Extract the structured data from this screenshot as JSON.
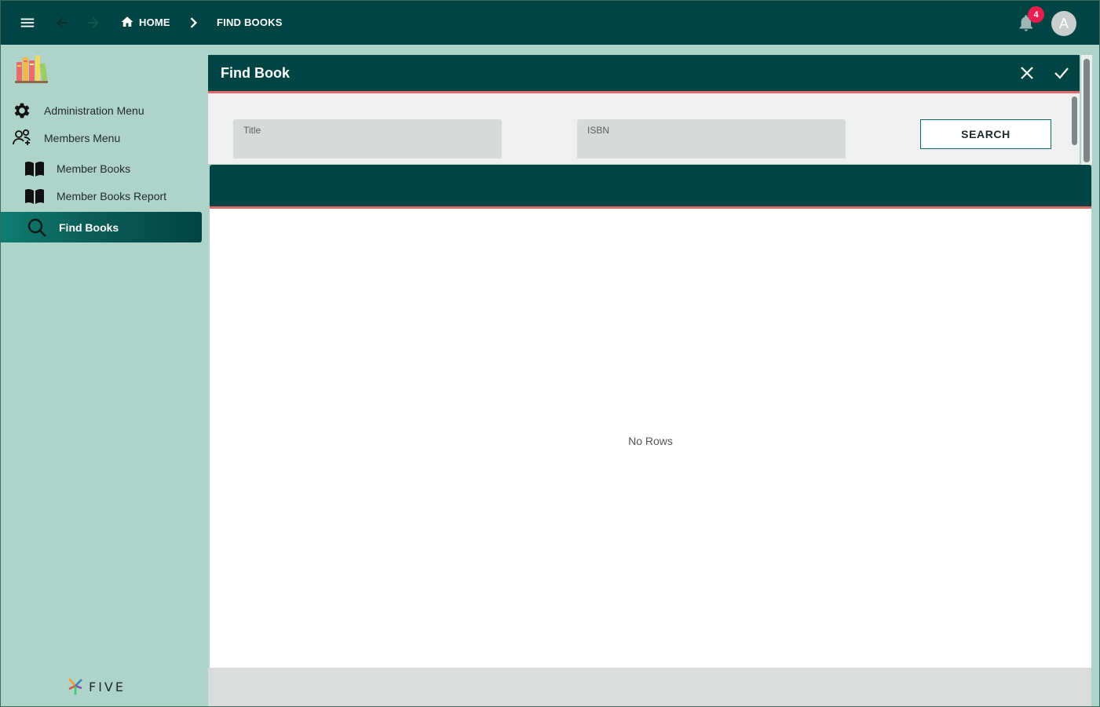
{
  "topbar": {
    "breadcrumb_home": "HOME",
    "breadcrumb_current": "FIND BOOKS",
    "notification_count": "4",
    "avatar_initial": "A"
  },
  "sidebar": {
    "items": [
      {
        "label": "Administration Menu",
        "icon": "gear-icon"
      },
      {
        "label": "Members Menu",
        "icon": "users-icon"
      },
      {
        "label": "Member Books",
        "icon": "book-icon"
      },
      {
        "label": "Member Books Report",
        "icon": "book-icon"
      },
      {
        "label": "Find Books",
        "icon": "search-icon",
        "active": true
      }
    ],
    "brand": "FIVE"
  },
  "panel": {
    "title": "Find Book"
  },
  "search": {
    "title_label": "Title",
    "title_value": "",
    "isbn_label": "ISBN",
    "isbn_value": "",
    "button_label": "SEARCH"
  },
  "grid": {
    "empty_text": "No Rows"
  },
  "colors": {
    "primary": "#004544",
    "sidebar": "#aed3c8",
    "accent_line": "#e06a6a",
    "badge": "#e91e4f"
  }
}
